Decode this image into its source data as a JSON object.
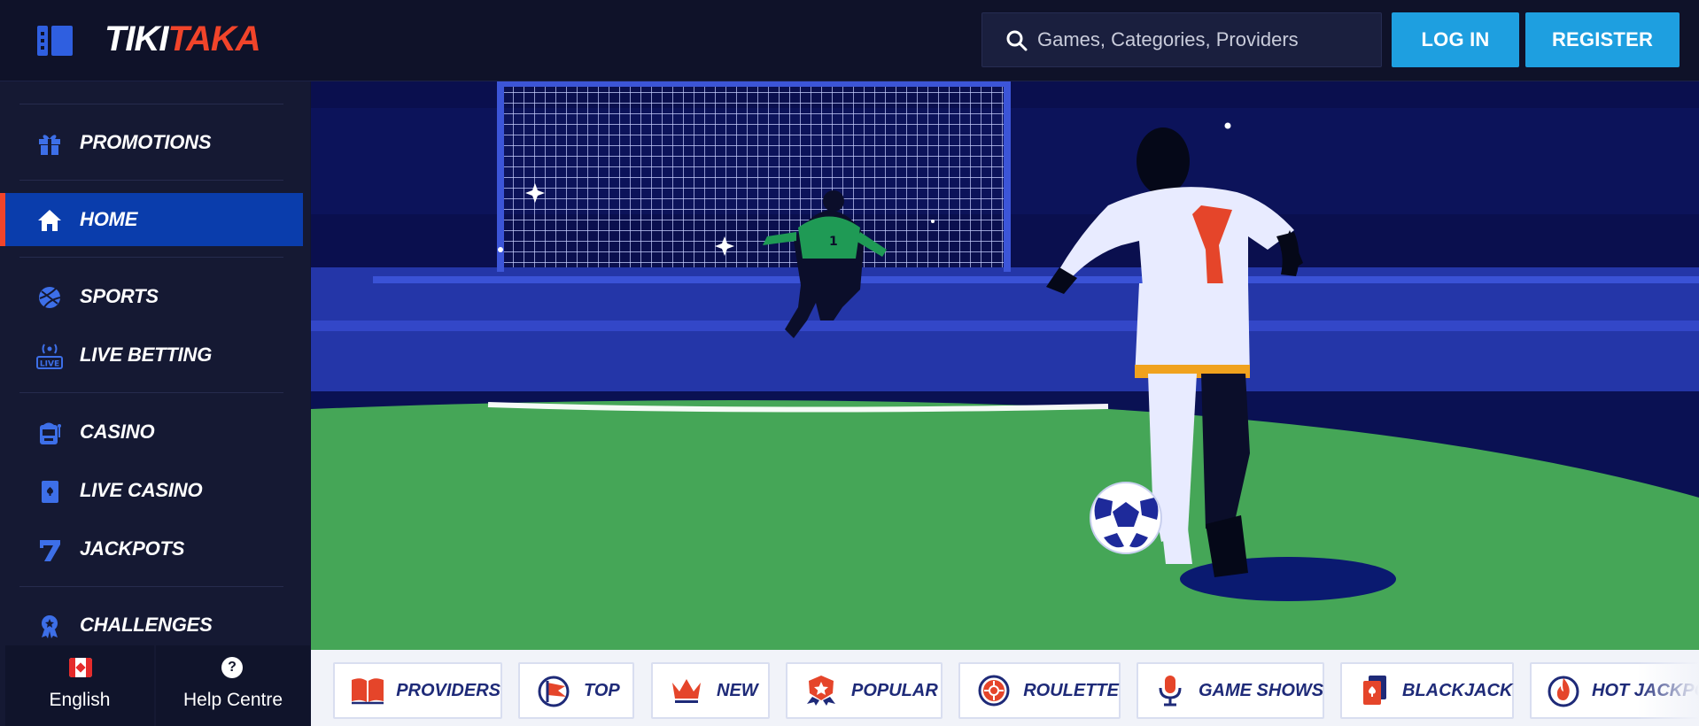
{
  "brand": {
    "part1": "TIKI",
    "part2": "TAKA"
  },
  "search": {
    "placeholder": "Games, Categories, Providers"
  },
  "header": {
    "login_label": "LOG IN",
    "register_label": "REGISTER"
  },
  "sidebar": {
    "items": [
      {
        "label": "PROMOTIONS",
        "icon": "gift-icon"
      },
      {
        "label": "HOME",
        "icon": "home-icon",
        "active": true
      },
      {
        "label": "SPORTS",
        "icon": "ball-icon"
      },
      {
        "label": "LIVE BETTING",
        "icon": "live-icon"
      },
      {
        "label": "CASINO",
        "icon": "slot-machine-icon"
      },
      {
        "label": "LIVE CASINO",
        "icon": "card-icon"
      },
      {
        "label": "JACKPOTS",
        "icon": "seven-icon"
      },
      {
        "label": "CHALLENGES",
        "icon": "badge-icon"
      }
    ],
    "footer": {
      "language": "English",
      "help": "Help Centre",
      "help_icon_text": "?"
    }
  },
  "hero": {
    "jersey_number": "7",
    "keeper_number": "1"
  },
  "categories": [
    {
      "label": "PROVIDERS",
      "icon": "book-icon"
    },
    {
      "label": "TOP",
      "icon": "flag-icon"
    },
    {
      "label": "NEW",
      "icon": "crown-icon"
    },
    {
      "label": "POPULAR",
      "icon": "star-badge-icon"
    },
    {
      "label": "ROULETTE",
      "icon": "roulette-icon"
    },
    {
      "label": "GAME SHOWS",
      "icon": "microphone-icon"
    },
    {
      "label": "BLACKJACK",
      "icon": "playing-card-icon"
    },
    {
      "label": "HOT JACKPOTS",
      "icon": "flame-icon"
    }
  ],
  "colors": {
    "accent_red": "#f1442a",
    "primary_blue": "#0a3dac",
    "button_blue": "#1e9fe0",
    "category_text": "#1e2a78"
  }
}
